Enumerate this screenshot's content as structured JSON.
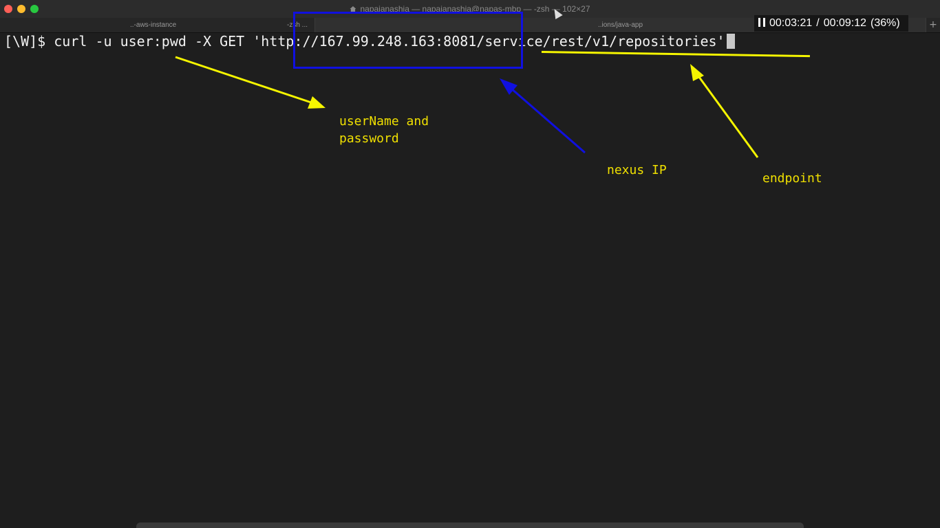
{
  "window": {
    "title": "napajanashia — napajanashia@napas-mbp — -zsh — 102×27",
    "tabs": [
      {
        "label": "..-aws-instance"
      },
      {
        "label": "-zsh ..."
      },
      {
        "label": "..ions/java-app"
      }
    ],
    "add_tab_label": "+"
  },
  "playback": {
    "elapsed": "00:03:21",
    "separator": "/",
    "total": "00:09:12",
    "percent": "(36%)"
  },
  "terminal": {
    "prompt": "[\\W]$ ",
    "command": "curl -u user:pwd -X GET 'http://167.99.248.163:8081/service/rest/v1/repositories'"
  },
  "annotations": {
    "user_pass": "userName and\npassword",
    "nexus_ip": "nexus IP",
    "endpoint": "endpoint"
  },
  "colors": {
    "annotation_yellow": "#f5f500",
    "annotation_blue": "#1010e0"
  }
}
